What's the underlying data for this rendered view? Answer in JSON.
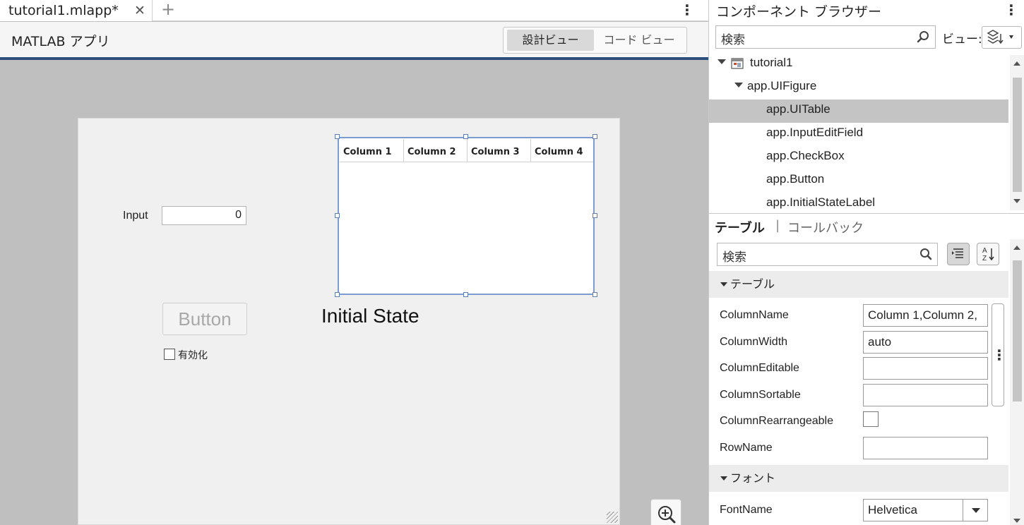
{
  "editor": {
    "tab_label": "tutorial1.mlapp*",
    "tab_close": "✕",
    "new_tab": "+",
    "menu_glyph": "⋮",
    "app_title": "MATLAB アプリ",
    "design_view_label": "設計ビュー",
    "code_view_label": "コード ビュー"
  },
  "figure": {
    "input_label": "Input",
    "input_value": "0",
    "button_label": "Button",
    "checkbox_label": "有効化",
    "state_label": "Initial State",
    "table_columns": [
      "Column 1",
      "Column 2",
      "Column 3",
      "Column 4"
    ]
  },
  "browser": {
    "title": "コンポーネント ブラウザー",
    "menu_glyph": "⋮",
    "search_placeholder": "検索",
    "view_label": "ビュー:",
    "tree": [
      {
        "label": "tutorial1",
        "level": 0,
        "expanded": true,
        "selected": false
      },
      {
        "label": "app.UIFigure",
        "level": 1,
        "expanded": true,
        "selected": false
      },
      {
        "label": "app.UITable",
        "level": 2,
        "selected": true
      },
      {
        "label": "app.InputEditField",
        "level": 2,
        "selected": false
      },
      {
        "label": "app.CheckBox",
        "level": 2,
        "selected": false
      },
      {
        "label": "app.Button",
        "level": 2,
        "selected": false
      },
      {
        "label": "app.InitialStateLabel",
        "level": 2,
        "selected": false
      }
    ]
  },
  "inspector": {
    "tab_active": "テーブル",
    "separator": "|",
    "tab_callback": "コールバック",
    "search_placeholder": "検索",
    "section_table": "テーブル",
    "section_font": "フォント",
    "more_glyph": "⋮",
    "props": [
      {
        "name": "ColumnName",
        "value": "Column 1,Column 2,",
        "kind": "text"
      },
      {
        "name": "ColumnWidth",
        "value": "auto",
        "kind": "text"
      },
      {
        "name": "ColumnEditable",
        "value": "",
        "kind": "text"
      },
      {
        "name": "ColumnSortable",
        "value": "",
        "kind": "text"
      },
      {
        "name": "ColumnRearrangeable",
        "value": false,
        "kind": "checkbox"
      },
      {
        "name": "RowName",
        "value": "",
        "kind": "text"
      }
    ],
    "font_name_label": "FontName",
    "font_name_value": "Helvetica"
  },
  "colors": {
    "accent": "#2e4e7e",
    "selection": "#c4c4c4",
    "canvas": "#bfbfbf",
    "figure": "#f0f0f0",
    "table_border": "#7c9ccf"
  }
}
